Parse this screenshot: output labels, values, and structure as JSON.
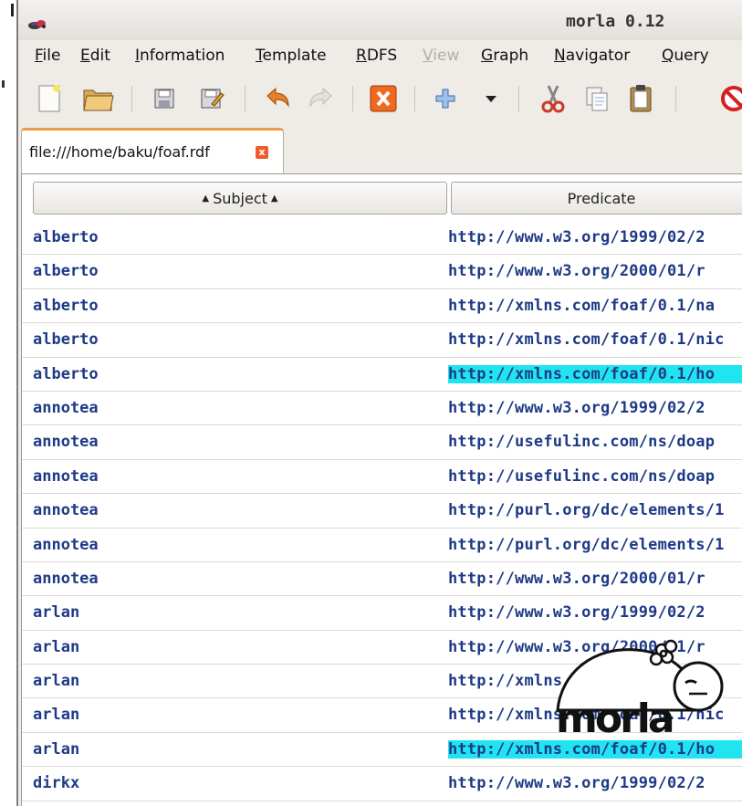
{
  "window": {
    "title": "morla 0.12"
  },
  "menu": {
    "items": [
      {
        "label": "File",
        "mnemonic": "F",
        "rest": "ile",
        "disabled": false
      },
      {
        "label": "Edit",
        "mnemonic": "E",
        "rest": "dit",
        "disabled": false
      },
      {
        "label": "Information",
        "mnemonic": "I",
        "rest": "nformation",
        "disabled": false
      },
      {
        "label": "Template",
        "mnemonic": "T",
        "rest": "emplate",
        "disabled": false
      },
      {
        "label": "RDFS",
        "mnemonic": "R",
        "rest": "DFS",
        "disabled": false
      },
      {
        "label": "View",
        "mnemonic": "V",
        "rest": "iew",
        "disabled": true
      },
      {
        "label": "Graph",
        "mnemonic": "G",
        "rest": "raph",
        "disabled": false
      },
      {
        "label": "Navigator",
        "mnemonic": "N",
        "rest": "avigator",
        "disabled": false
      },
      {
        "label": "Query",
        "mnemonic": "Q",
        "rest": "uery",
        "disabled": false
      }
    ]
  },
  "toolbar": {
    "buttons": [
      "new-document-icon",
      "open-folder-icon",
      "save-icon",
      "save-as-icon",
      "undo-icon",
      "redo-icon",
      "close-x-icon",
      "add-icon",
      "dropdown-arrow-icon",
      "cut-icon",
      "copy-icon",
      "paste-icon",
      "stop-icon"
    ]
  },
  "tab": {
    "label": "file:///home/baku/foaf.rdf",
    "close_glyph": "x"
  },
  "table": {
    "columns": {
      "subject": "Subject",
      "predicate": "Predicate"
    },
    "sort_arrow": "▲",
    "rows": [
      {
        "subject": "alberto",
        "predicate": "http://www.w3.org/1999/02/2",
        "highlight": false
      },
      {
        "subject": "alberto",
        "predicate": "http://www.w3.org/2000/01/r",
        "highlight": false
      },
      {
        "subject": "alberto",
        "predicate": "http://xmlns.com/foaf/0.1/na",
        "highlight": false
      },
      {
        "subject": "alberto",
        "predicate": "http://xmlns.com/foaf/0.1/nic",
        "highlight": false
      },
      {
        "subject": "alberto",
        "predicate": "http://xmlns.com/foaf/0.1/ho",
        "highlight": true
      },
      {
        "subject": "annotea",
        "predicate": "http://www.w3.org/1999/02/2",
        "highlight": false
      },
      {
        "subject": "annotea",
        "predicate": "http://usefulinc.com/ns/doap",
        "highlight": false
      },
      {
        "subject": "annotea",
        "predicate": "http://usefulinc.com/ns/doap",
        "highlight": false
      },
      {
        "subject": "annotea",
        "predicate": "http://purl.org/dc/elements/1",
        "highlight": false
      },
      {
        "subject": "annotea",
        "predicate": "http://purl.org/dc/elements/1",
        "highlight": false
      },
      {
        "subject": "annotea",
        "predicate": "http://www.w3.org/2000/01/r",
        "highlight": false
      },
      {
        "subject": "arlan",
        "predicate": "http://www.w3.org/1999/02/2",
        "highlight": false
      },
      {
        "subject": "arlan",
        "predicate": "http://www.w3.org/2000/01/r",
        "highlight": false
      },
      {
        "subject": "arlan",
        "predicate": "http://xmlns.com/foaf/0.1/na",
        "highlight": false
      },
      {
        "subject": "arlan",
        "predicate": "http://xmlns.com/foaf/0.1/nic",
        "highlight": false
      },
      {
        "subject": "arlan",
        "predicate": "http://xmlns.com/foaf/0.1/ho",
        "highlight": true
      },
      {
        "subject": "dirkx",
        "predicate": "http://www.w3.org/1999/02/2",
        "highlight": false
      }
    ]
  },
  "splash_logo": {
    "text": "morla"
  },
  "colors": {
    "link_text": "#1e3a86",
    "highlight": "#20e4f0",
    "tab_accent": "#f19a4a",
    "close_red": "#ee5b2c"
  }
}
